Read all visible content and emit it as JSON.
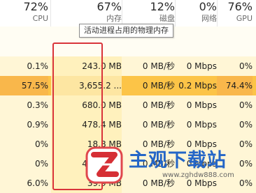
{
  "columns": [
    {
      "pct": "72%",
      "label": "CPU"
    },
    {
      "pct": "67%",
      "label": "内存"
    },
    {
      "pct": "12%",
      "label": "磁盘"
    },
    {
      "pct": "0%",
      "label": "网络"
    },
    {
      "pct": "76%",
      "label": "GPU"
    }
  ],
  "tooltip": "活动进程占用的物理内存",
  "rows": [
    {
      "cpu": "0.1%",
      "mem": "243.0 MB",
      "disk": "0 MB/秒",
      "net": "0 Mbps",
      "gpu": "0%"
    },
    {
      "cpu": "57.5%",
      "mem": "3,655.2 ...",
      "disk": "0 MB/秒",
      "net": "0.2 Mbps",
      "gpu": "74.4%"
    },
    {
      "cpu": "0.3%",
      "mem": "680.0 MB",
      "disk": "0 MB/秒",
      "net": "0 Mbps",
      "gpu": "0%"
    },
    {
      "cpu": "0.9%",
      "mem": "478.4 MB",
      "disk": "0 MB/秒",
      "net": "0 Mbps",
      "gpu": "0%"
    },
    {
      "cpu": "0%",
      "mem": "18.8 MB",
      "disk": "0 MB/秒",
      "net": "0 Mbps",
      "gpu": "0%"
    },
    {
      "cpu": "0%",
      "mem": "451.6 MB",
      "disk": "0 MB/秒",
      "net": "0 Mbps",
      "gpu": "0%"
    },
    {
      "cpu": "6.0%",
      "mem": "39.9 MB",
      "disk": "0 MB/秒",
      "net": "0 Mbps",
      "gpu": "0%"
    }
  ],
  "watermark": {
    "title": "主观下载站",
    "url": "www.zghdw888.com"
  },
  "colors": {
    "highlight_row": "#fcc447",
    "pale_row": "#fff6d6",
    "annotation_box": "#d9343a",
    "watermark_blue": "#2466c7"
  }
}
